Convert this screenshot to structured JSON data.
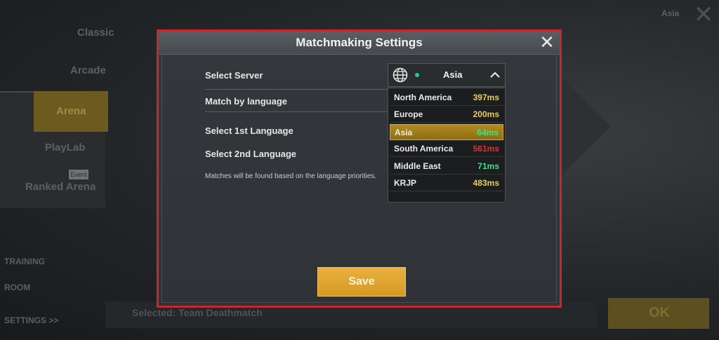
{
  "background": {
    "menu_items": [
      "Classic",
      "Arcade",
      "Arena",
      "PlayLab",
      "Ranked Arena"
    ],
    "new_badge": "Event",
    "side_items": [
      "TRAINING",
      "ROOM",
      "SETTINGS >>"
    ],
    "bottom_text": "Selected: Team Deathmatch",
    "ok_label": "OK",
    "region_label": "Asia"
  },
  "modal": {
    "title": "Matchmaking Settings",
    "close_icon": "close-icon",
    "rows": {
      "select_server": "Select Server",
      "match_by_language": "Match by language",
      "select_1st_language": "Select 1st Language",
      "select_2nd_language": "Select 2nd Language"
    },
    "hint": "Matches will be found based on the language priorities.",
    "server_select": {
      "value": "Asia",
      "icon": "globe-icon",
      "status_color": "#26c9a0"
    },
    "servers": [
      {
        "name": "North America",
        "ping": "397ms",
        "color": "#e8cf56"
      },
      {
        "name": "Europe",
        "ping": "200ms",
        "color": "#e8cf56"
      },
      {
        "name": "Asia",
        "ping": "64ms",
        "color": "#3fe08c",
        "selected": true
      },
      {
        "name": "South America",
        "ping": "561ms",
        "color": "#e0322c"
      },
      {
        "name": "Middle East",
        "ping": "71ms",
        "color": "#3fe08c"
      },
      {
        "name": "KRJP",
        "ping": "483ms",
        "color": "#e8cf56"
      }
    ],
    "save_label": "Save"
  },
  "colors": {
    "modal_border": "#c6282c",
    "save_button": "#e3a733",
    "selected_row": "#a8841c"
  }
}
